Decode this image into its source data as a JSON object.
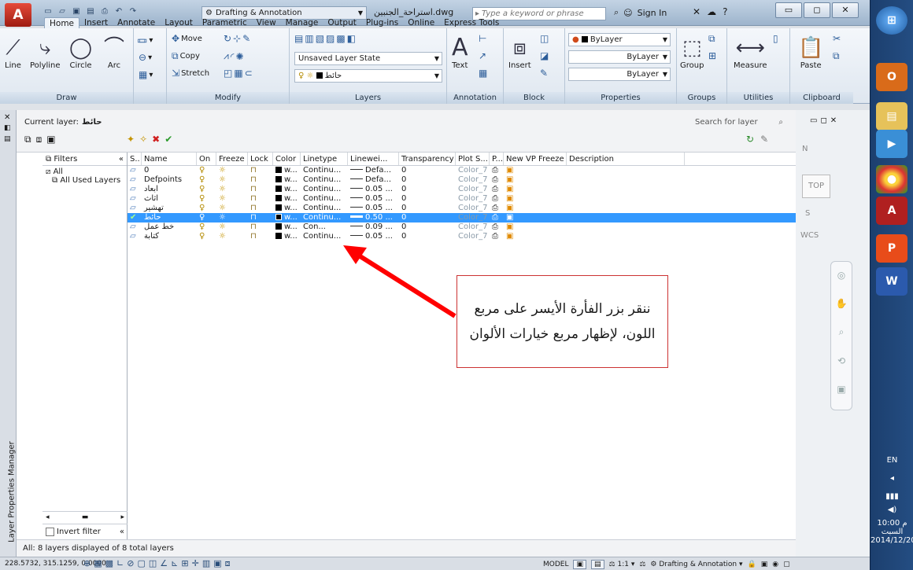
{
  "app": {
    "workspace": "Drafting & Annotation",
    "document": "استراحة_الجنبين.dwg",
    "search_placeholder": "Type a keyword or phrase",
    "sign_in": "Sign In"
  },
  "tabs": [
    "Home",
    "Insert",
    "Annotate",
    "Layout",
    "Parametric",
    "View",
    "Manage",
    "Output",
    "Plug-ins",
    "Online",
    "Express Tools"
  ],
  "ribbon": {
    "draw": {
      "title": "Draw",
      "line": "Line",
      "polyline": "Polyline",
      "circle": "Circle",
      "arc": "Arc"
    },
    "modify": {
      "title": "Modify",
      "move": "Move",
      "copy": "Copy",
      "stretch": "Stretch"
    },
    "layers": {
      "title": "Layers",
      "layer_state": "Unsaved Layer State",
      "current_layer": "حائط"
    },
    "annotation": {
      "title": "Annotation",
      "text": "Text"
    },
    "block": {
      "title": "Block",
      "insert": "Insert"
    },
    "properties": {
      "title": "Properties",
      "color": "ByLayer",
      "linetype": "ByLayer",
      "lineweight": "ByLayer"
    },
    "groups": {
      "title": "Groups",
      "group": "Group"
    },
    "utilities": {
      "title": "Utilities",
      "measure": "Measure"
    },
    "clipboard": {
      "title": "Clipboard",
      "paste": "Paste"
    }
  },
  "layer_manager": {
    "panel_title": "Layer Properties Manager",
    "current_layer_label": "Current layer:",
    "current_layer": "حائط",
    "search_placeholder": "Search for layer",
    "filters_label": "Filters",
    "tree": [
      "All",
      "All Used Layers"
    ],
    "invert_filter": "Invert filter",
    "status": "All: 8 layers displayed of 8 total layers",
    "columns": [
      "S..",
      "Name",
      "On",
      "Freeze",
      "Lock",
      "Color",
      "Linetype",
      "Linewei...",
      "Transparency",
      "Plot S...",
      "P...",
      "New VP Freeze",
      "Description"
    ],
    "rows": [
      {
        "name": "0",
        "color": "w...",
        "linetype": "Continu...",
        "lineweight": "Defa...",
        "transparency": "0",
        "plot_style": "Color_7",
        "selected": false
      },
      {
        "name": "Defpoints",
        "color": "w...",
        "linetype": "Continu...",
        "lineweight": "Defa...",
        "transparency": "0",
        "plot_style": "Color_7",
        "selected": false
      },
      {
        "name": "ابعاد",
        "color": "w...",
        "linetype": "Continu...",
        "lineweight": "0.05 ...",
        "transparency": "0",
        "plot_style": "Color_7",
        "selected": false
      },
      {
        "name": "اثاث",
        "color": "w...",
        "linetype": "Continu...",
        "lineweight": "0.05 ...",
        "transparency": "0",
        "plot_style": "Color_7",
        "selected": false
      },
      {
        "name": "تهشير",
        "color": "w...",
        "linetype": "Continu...",
        "lineweight": "0.05 ...",
        "transparency": "0",
        "plot_style": "Color_7",
        "selected": false
      },
      {
        "name": "حائط",
        "color": "w...",
        "linetype": "Continu...",
        "lineweight": "0.50 ...",
        "transparency": "0",
        "plot_style": "Color_7",
        "selected": true
      },
      {
        "name": "خط عمل",
        "color": "w...",
        "linetype": "Con...",
        "lineweight": "0.09 ...",
        "transparency": "0",
        "plot_style": "Color_7",
        "selected": false
      },
      {
        "name": "كتابة",
        "color": "w...",
        "linetype": "Continu...",
        "lineweight": "0.05 ...",
        "transparency": "0",
        "plot_style": "Color_7",
        "selected": false
      }
    ]
  },
  "viewcube": {
    "north": "N",
    "face": "TOP",
    "south": "S",
    "wcs": "WCS"
  },
  "annotation_callout": "ننقر بزر الفأرة الأيسر على مربع اللون، لإظهار مربع خيارات الألوان",
  "statusbar": {
    "coords": "228.5732, 315.1259, 0.0000",
    "model": "MODEL",
    "scale": "1:1",
    "workspace": "Drafting & Annotation"
  },
  "taskbar": {
    "lang": "EN",
    "time": "10:00 م",
    "day": "السبت",
    "date": "2014/12/20"
  },
  "colors": {
    "selection": "#3399ff",
    "arrow": "#ff0000",
    "callout_border": "#cc3333"
  }
}
